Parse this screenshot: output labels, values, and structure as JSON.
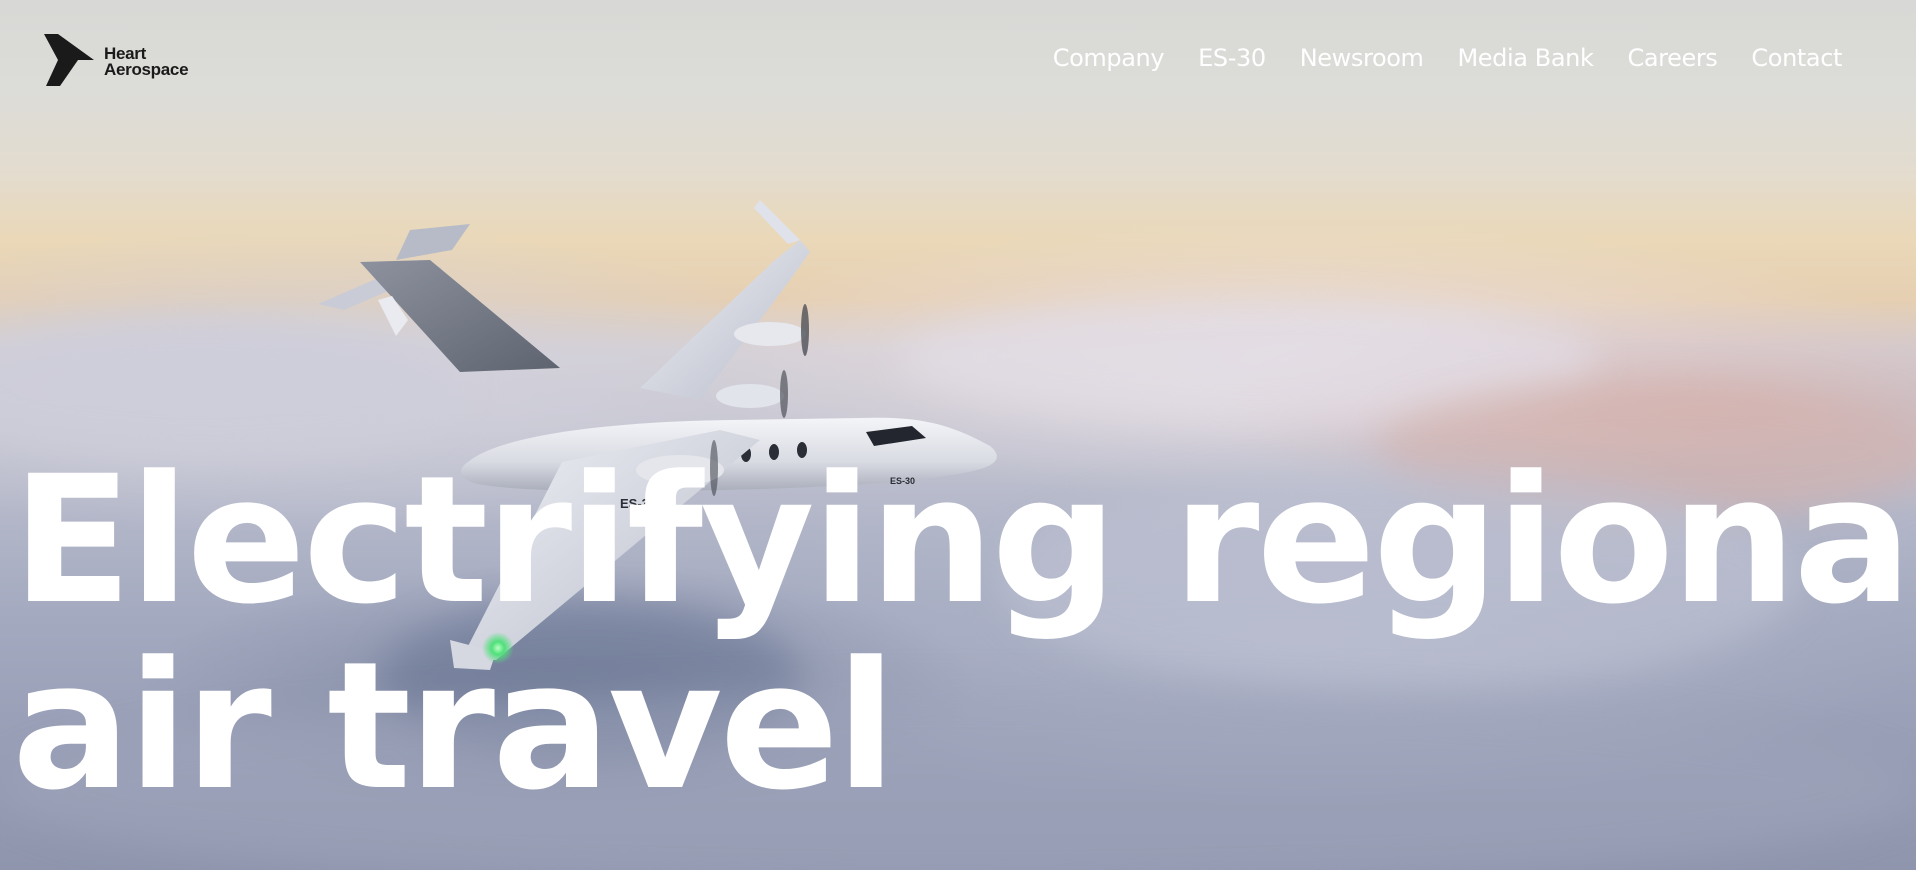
{
  "brand": {
    "name_line1": "Heart",
    "name_line2": "Aerospace",
    "logo_icon": "heart-aerospace-logo-icon"
  },
  "nav": {
    "items": [
      {
        "label": "Company"
      },
      {
        "label": "ES-30"
      },
      {
        "label": "Newsroom"
      },
      {
        "label": "Media Bank"
      },
      {
        "label": "Careers"
      },
      {
        "label": "Contact"
      }
    ]
  },
  "hero": {
    "headline_line1": "Electrifying regional",
    "headline_line2": "air travel",
    "image": "aircraft-above-clouds-image",
    "aircraft_marking": "ES-30",
    "aircraft_brand_marking": "Heart Aerospace"
  },
  "colors": {
    "text_on_hero": "#ffffff",
    "logo_dark": "#1a1a1a",
    "sky_top": "#d8d8d6",
    "sunset_band": "#ead8b8",
    "cloud_base": "#9aa0b7"
  }
}
